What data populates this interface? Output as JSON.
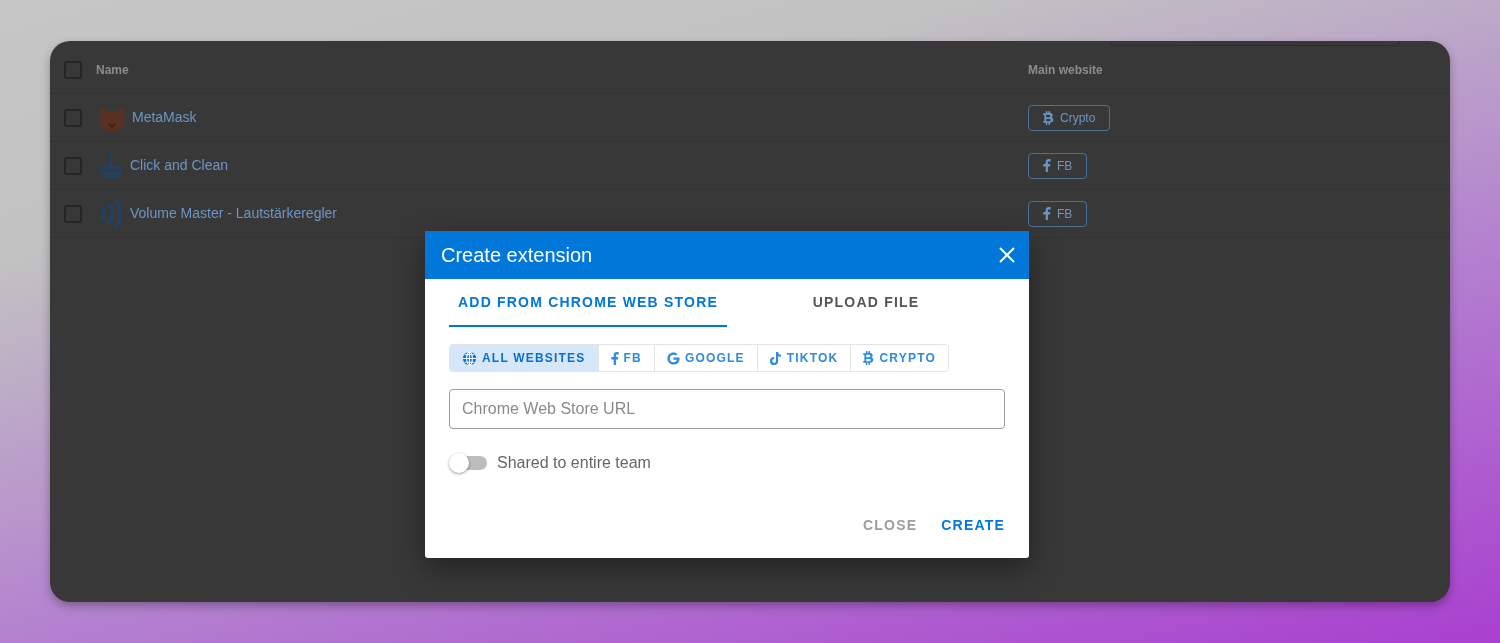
{
  "table": {
    "header_checked": false,
    "columns": [
      "Name",
      "Main website"
    ],
    "rows": [
      {
        "name": "MetaMask",
        "checked": false,
        "website": {
          "label": "Crypto",
          "kind": "crypto"
        }
      },
      {
        "name": "Click and Clean",
        "checked": false,
        "website": {
          "label": "FB",
          "kind": "fb"
        }
      },
      {
        "name": "Volume Master - Lautstärkeregler",
        "checked": false,
        "website": {
          "label": "FB",
          "kind": "fb"
        }
      }
    ]
  },
  "dialog": {
    "title": "Create extension",
    "tabs": [
      {
        "label": "ADD FROM CHROME WEB STORE",
        "selected": true
      },
      {
        "label": "UPLOAD FILE",
        "selected": false
      }
    ],
    "websites": [
      {
        "label": "ALL WEBSITES",
        "kind": "all",
        "selected": true
      },
      {
        "label": "FB",
        "kind": "fb",
        "selected": false
      },
      {
        "label": "GOOGLE",
        "kind": "google",
        "selected": false
      },
      {
        "label": "TIKTOK",
        "kind": "tiktok",
        "selected": false
      },
      {
        "label": "CRYPTO",
        "kind": "crypto",
        "selected": false
      }
    ],
    "url_field": {
      "placeholder": "Chrome Web Store URL"
    },
    "share_toggle": {
      "label": "Shared to entire team",
      "on": false
    },
    "buttons": [
      {
        "label": "CLOSE",
        "kind": "secondary"
      },
      {
        "label": "CREATE",
        "kind": "primary"
      }
    ]
  }
}
